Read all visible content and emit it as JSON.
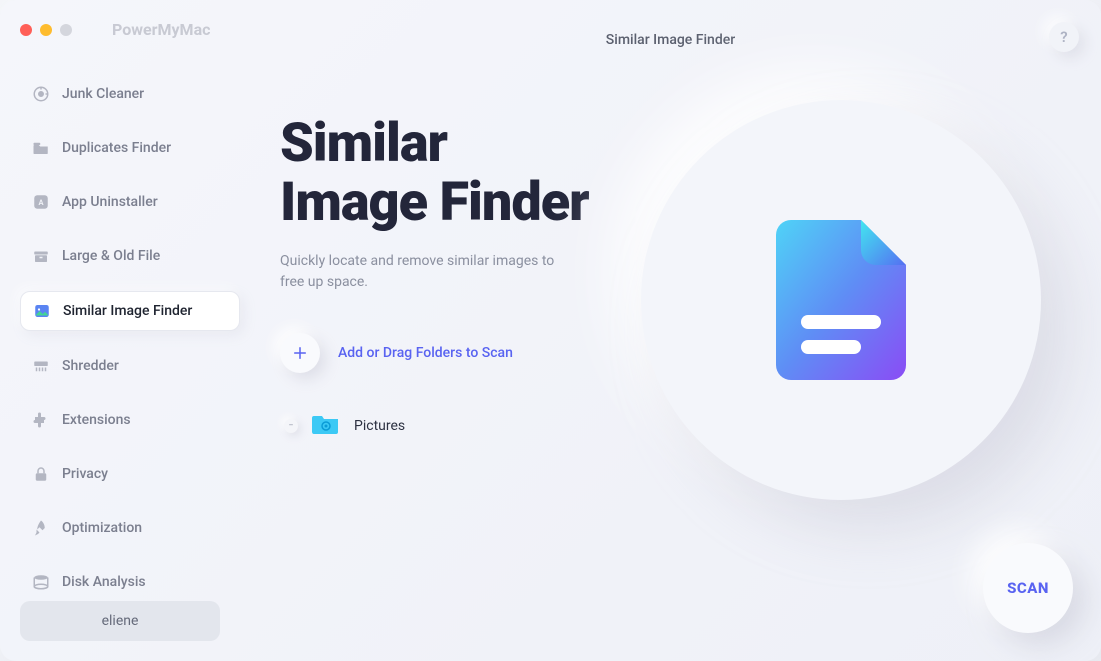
{
  "app_name": "PowerMyMac",
  "header_title": "Similar Image Finder",
  "help_label": "?",
  "sidebar": {
    "items": [
      {
        "label": "Junk Cleaner"
      },
      {
        "label": "Duplicates Finder"
      },
      {
        "label": "App Uninstaller"
      },
      {
        "label": "Large & Old File"
      },
      {
        "label": "Similar Image Finder"
      },
      {
        "label": "Shredder"
      },
      {
        "label": "Extensions"
      },
      {
        "label": "Privacy"
      },
      {
        "label": "Optimization"
      },
      {
        "label": "Disk Analysis"
      }
    ],
    "user": "eliene"
  },
  "main": {
    "title_line1": "Similar",
    "title_line2": "Image Finder",
    "subtitle": "Quickly locate and remove similar images to free up space.",
    "add_label": "Add or Drag Folders to Scan",
    "folders": [
      {
        "name": "Pictures"
      }
    ],
    "scan_label": "SCAN"
  },
  "colors": {
    "accent": "#5963f1",
    "text_dark": "#23263a",
    "text_muted": "#8a8f9f"
  }
}
